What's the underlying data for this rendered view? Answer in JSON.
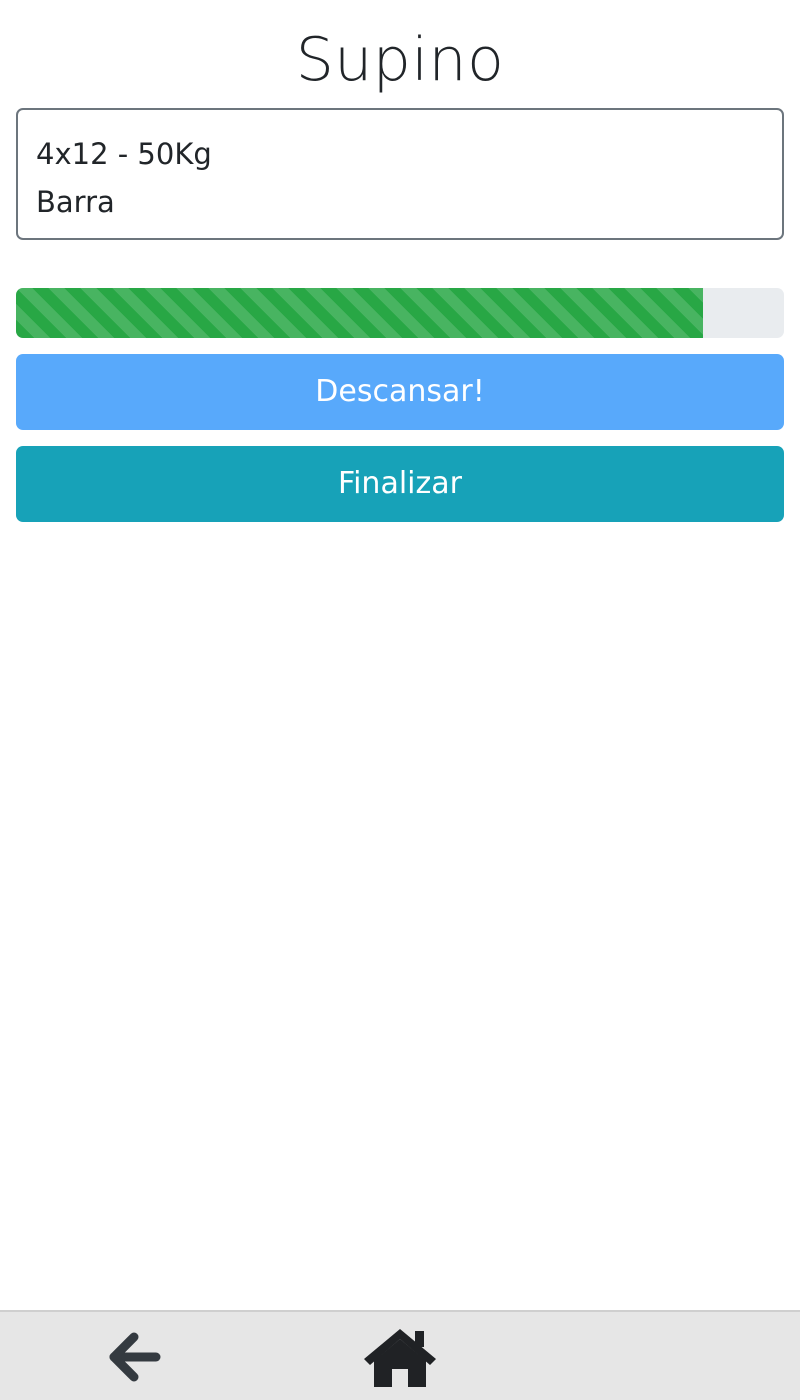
{
  "exercise": {
    "title": "Supino",
    "details_lines": [
      "4x12 - 50Kg",
      "Barra"
    ]
  },
  "progress": {
    "percent": 89.5,
    "color": "#28a745",
    "track_color": "#e9ecef"
  },
  "actions": {
    "rest_label": "Descansar!",
    "rest_color": "#58a9fb",
    "finish_label": "Finalizar",
    "finish_color": "#17a2b8"
  },
  "footer_nav": {
    "back_icon": "arrow-left-icon",
    "home_icon": "home-icon",
    "icon_color": "#343a40"
  }
}
